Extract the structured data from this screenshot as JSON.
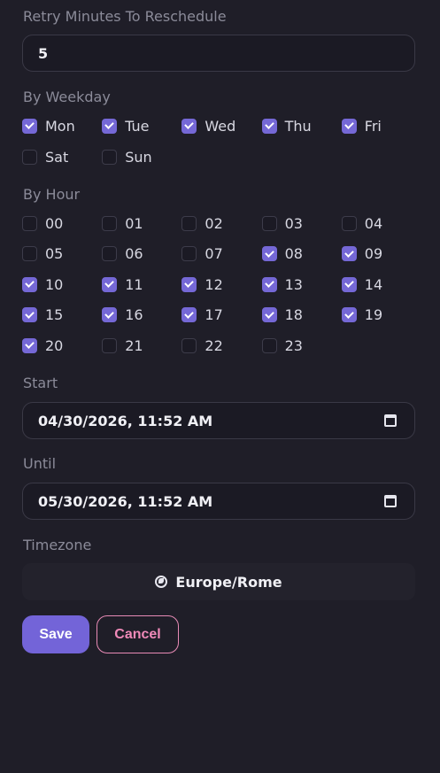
{
  "retry": {
    "label": "Retry Minutes To Reschedule",
    "value": "5"
  },
  "weekday": {
    "label": "By Weekday",
    "items": [
      {
        "label": "Mon",
        "checked": true
      },
      {
        "label": "Tue",
        "checked": true
      },
      {
        "label": "Wed",
        "checked": true
      },
      {
        "label": "Thu",
        "checked": true
      },
      {
        "label": "Fri",
        "checked": true
      },
      {
        "label": "Sat",
        "checked": false
      },
      {
        "label": "Sun",
        "checked": false
      }
    ]
  },
  "hour": {
    "label": "By Hour",
    "items": [
      {
        "label": "00",
        "checked": false
      },
      {
        "label": "01",
        "checked": false
      },
      {
        "label": "02",
        "checked": false
      },
      {
        "label": "03",
        "checked": false
      },
      {
        "label": "04",
        "checked": false
      },
      {
        "label": "05",
        "checked": false
      },
      {
        "label": "06",
        "checked": false
      },
      {
        "label": "07",
        "checked": false
      },
      {
        "label": "08",
        "checked": true
      },
      {
        "label": "09",
        "checked": true
      },
      {
        "label": "10",
        "checked": true
      },
      {
        "label": "11",
        "checked": true
      },
      {
        "label": "12",
        "checked": true
      },
      {
        "label": "13",
        "checked": true
      },
      {
        "label": "14",
        "checked": true
      },
      {
        "label": "15",
        "checked": true
      },
      {
        "label": "16",
        "checked": true
      },
      {
        "label": "17",
        "checked": true
      },
      {
        "label": "18",
        "checked": true
      },
      {
        "label": "19",
        "checked": true
      },
      {
        "label": "20",
        "checked": true
      },
      {
        "label": "21",
        "checked": false
      },
      {
        "label": "22",
        "checked": false
      },
      {
        "label": "23",
        "checked": false
      }
    ]
  },
  "start": {
    "label": "Start",
    "value": "04/30/2026, 11:52 AM"
  },
  "until": {
    "label": "Until",
    "value": "05/30/2026, 11:52 AM"
  },
  "timezone": {
    "label": "Timezone",
    "value": "Europe/Rome",
    "icon": "globe-icon"
  },
  "actions": {
    "save_label": "Save",
    "cancel_label": "Cancel"
  },
  "colors": {
    "accent": "#7364d8",
    "cancel": "#f08ab9",
    "background": "#1f1e28"
  }
}
